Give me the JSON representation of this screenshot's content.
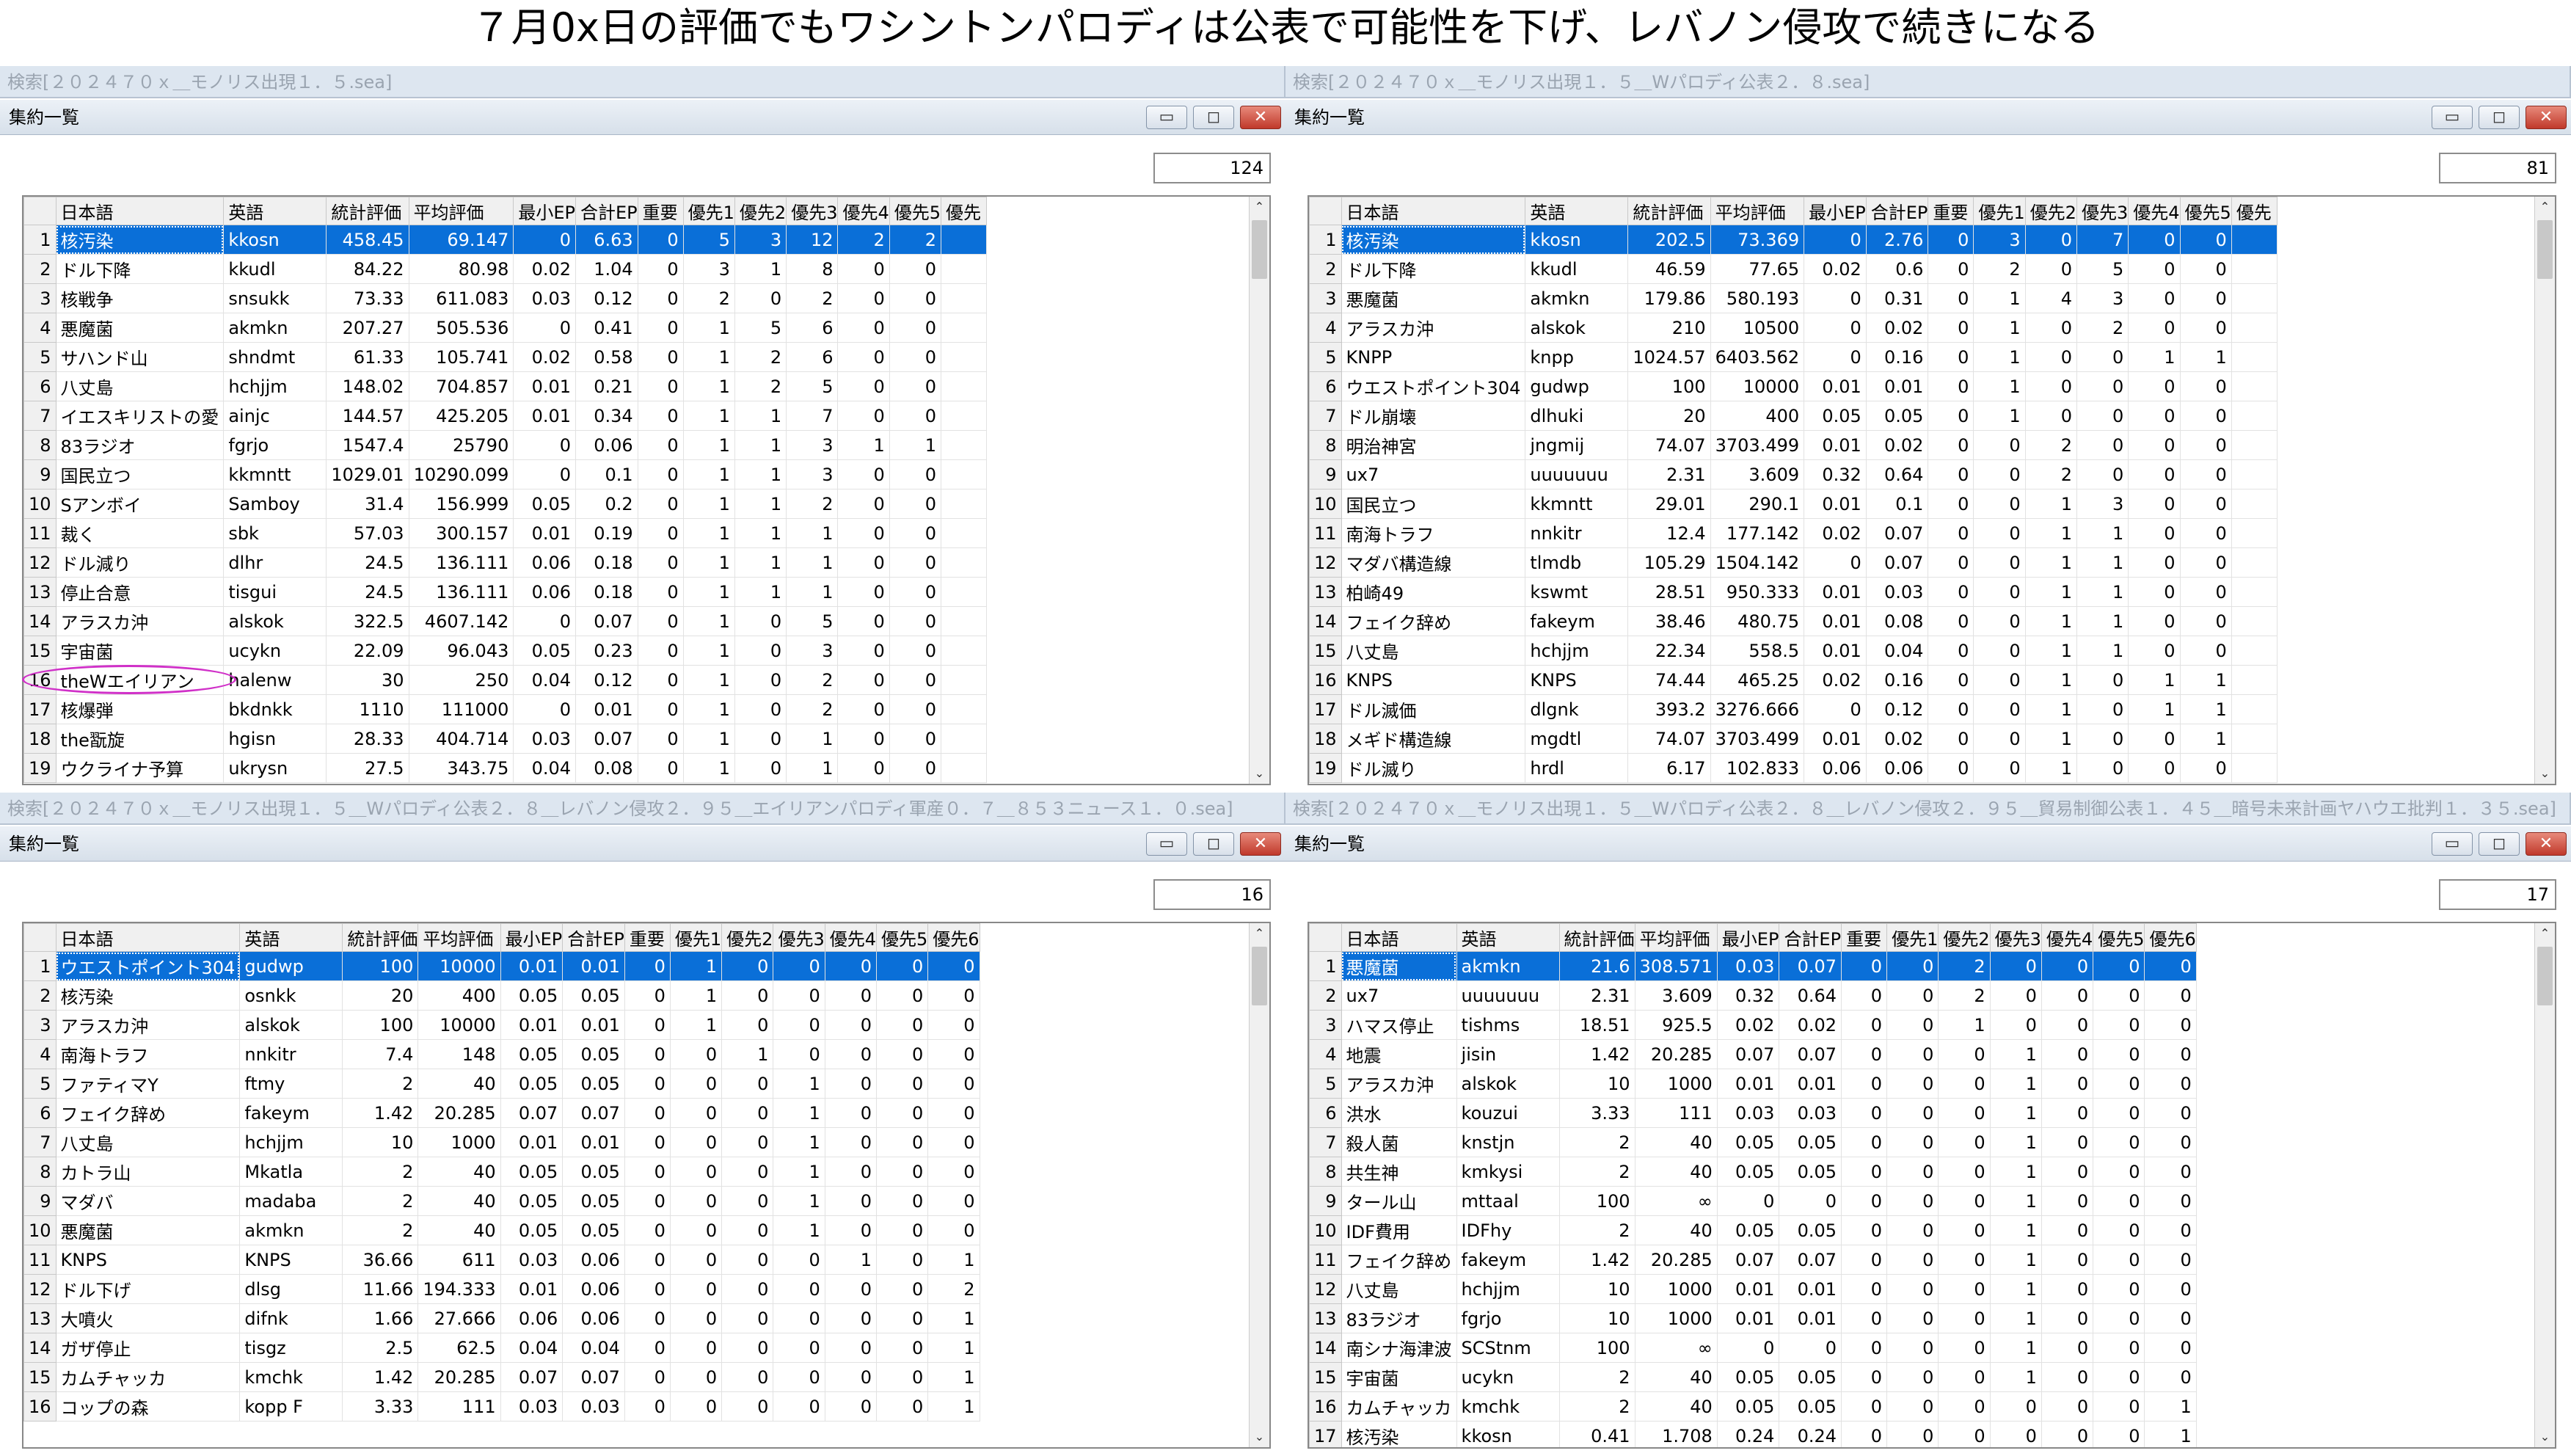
{
  "title": "７月0x日の評価でもワシントンパロディは公表で可能性を下げ、レバノン侵攻で続きになる",
  "panels": [
    {
      "search": "検索[２０２４７０ｘ＿モノリス出現１．５.sea]",
      "window_title": "集約一覧",
      "count": "124",
      "columns": [
        "日本語",
        "英語",
        "統計評価",
        "平均評価",
        "最小EP",
        "合計EP",
        "重要",
        "優先1",
        "優先2",
        "優先3",
        "優先4",
        "優先5",
        "優先"
      ],
      "rows": [
        [
          "1",
          "核汚染",
          "kkosn",
          "458.45",
          "69.147",
          "0",
          "6.63",
          "0",
          "5",
          "3",
          "12",
          "2",
          "2",
          ""
        ],
        [
          "2",
          "ドル下降",
          "kkudl",
          "84.22",
          "80.98",
          "0.02",
          "1.04",
          "0",
          "3",
          "1",
          "8",
          "0",
          "0",
          ""
        ],
        [
          "3",
          "核戦争",
          "snsukk",
          "73.33",
          "611.083",
          "0.03",
          "0.12",
          "0",
          "2",
          "0",
          "2",
          "0",
          "0",
          ""
        ],
        [
          "4",
          "悪魔菌",
          "akmkn",
          "207.27",
          "505.536",
          "0",
          "0.41",
          "0",
          "1",
          "5",
          "6",
          "0",
          "0",
          ""
        ],
        [
          "5",
          "サハンド山",
          "shndmt",
          "61.33",
          "105.741",
          "0.02",
          "0.58",
          "0",
          "1",
          "2",
          "6",
          "0",
          "0",
          ""
        ],
        [
          "6",
          "八丈島",
          "hchjjm",
          "148.02",
          "704.857",
          "0.01",
          "0.21",
          "0",
          "1",
          "2",
          "5",
          "0",
          "0",
          ""
        ],
        [
          "7",
          "イエスキリストの愛",
          "ainjc",
          "144.57",
          "425.205",
          "0.01",
          "0.34",
          "0",
          "1",
          "1",
          "7",
          "0",
          "0",
          ""
        ],
        [
          "8",
          "83ラジオ",
          "fgrjo",
          "1547.4",
          "25790",
          "0",
          "0.06",
          "0",
          "1",
          "1",
          "3",
          "1",
          "1",
          ""
        ],
        [
          "9",
          "国民立つ",
          "kkmntt",
          "1029.01",
          "10290.099",
          "0",
          "0.1",
          "0",
          "1",
          "1",
          "3",
          "0",
          "0",
          ""
        ],
        [
          "10",
          "Sアンボイ",
          "Samboy",
          "31.4",
          "156.999",
          "0.05",
          "0.2",
          "0",
          "1",
          "1",
          "2",
          "0",
          "0",
          ""
        ],
        [
          "11",
          "裁く",
          "sbk",
          "57.03",
          "300.157",
          "0.01",
          "0.19",
          "0",
          "1",
          "1",
          "1",
          "0",
          "0",
          ""
        ],
        [
          "12",
          "ドル減り",
          "dlhr",
          "24.5",
          "136.111",
          "0.06",
          "0.18",
          "0",
          "1",
          "1",
          "1",
          "0",
          "0",
          ""
        ],
        [
          "13",
          "停止合意",
          "tisgui",
          "24.5",
          "136.111",
          "0.06",
          "0.18",
          "0",
          "1",
          "1",
          "1",
          "0",
          "0",
          ""
        ],
        [
          "14",
          "アラスカ沖",
          "alskok",
          "322.5",
          "4607.142",
          "0",
          "0.07",
          "0",
          "1",
          "0",
          "5",
          "0",
          "0",
          ""
        ],
        [
          "15",
          "宇宙菌",
          "ucykn",
          "22.09",
          "96.043",
          "0.05",
          "0.23",
          "0",
          "1",
          "0",
          "3",
          "0",
          "0",
          ""
        ],
        [
          "16",
          "theWエイリアン",
          "halenw",
          "30",
          "250",
          "0.04",
          "0.12",
          "0",
          "1",
          "0",
          "2",
          "0",
          "0",
          ""
        ],
        [
          "17",
          "核爆弾",
          "bkdnkk",
          "1110",
          "111000",
          "0",
          "0.01",
          "0",
          "1",
          "0",
          "2",
          "0",
          "0",
          ""
        ],
        [
          "18",
          "the翫旋",
          "hgisn",
          "28.33",
          "404.714",
          "0.03",
          "0.07",
          "0",
          "1",
          "0",
          "1",
          "0",
          "0",
          ""
        ],
        [
          "19",
          "ウクライナ予算",
          "ukrysn",
          "27.5",
          "343.75",
          "0.04",
          "0.08",
          "0",
          "1",
          "0",
          "1",
          "0",
          "0",
          ""
        ]
      ]
    },
    {
      "search": "検索[２０２４７０ｘ＿モノリス出現１．５＿Wパロディ公表２．８.sea]",
      "window_title": "集約一覧",
      "count": "81",
      "columns": [
        "日本語",
        "英語",
        "統計評価",
        "平均評価",
        "最小EP",
        "合計EP",
        "重要",
        "優先1",
        "優先2",
        "優先3",
        "優先4",
        "優先5",
        "優先"
      ],
      "rows": [
        [
          "1",
          "核汚染",
          "kkosn",
          "202.5",
          "73.369",
          "0",
          "2.76",
          "0",
          "3",
          "0",
          "7",
          "0",
          "0",
          ""
        ],
        [
          "2",
          "ドル下降",
          "kkudl",
          "46.59",
          "77.65",
          "0.02",
          "0.6",
          "0",
          "2",
          "0",
          "5",
          "0",
          "0",
          ""
        ],
        [
          "3",
          "悪魔菌",
          "akmkn",
          "179.86",
          "580.193",
          "0",
          "0.31",
          "0",
          "1",
          "4",
          "3",
          "0",
          "0",
          ""
        ],
        [
          "4",
          "アラスカ沖",
          "alskok",
          "210",
          "10500",
          "0",
          "0.02",
          "0",
          "1",
          "0",
          "2",
          "0",
          "0",
          ""
        ],
        [
          "5",
          "KNPP",
          "knpp",
          "1024.57",
          "6403.562",
          "0",
          "0.16",
          "0",
          "1",
          "0",
          "0",
          "1",
          "1",
          ""
        ],
        [
          "6",
          "ウエストポイント304",
          "gudwp",
          "100",
          "10000",
          "0.01",
          "0.01",
          "0",
          "1",
          "0",
          "0",
          "0",
          "0",
          ""
        ],
        [
          "7",
          "ドル崩壊",
          "dlhuki",
          "20",
          "400",
          "0.05",
          "0.05",
          "0",
          "1",
          "0",
          "0",
          "0",
          "0",
          ""
        ],
        [
          "8",
          "明治神宮",
          "jngmij",
          "74.07",
          "3703.499",
          "0.01",
          "0.02",
          "0",
          "0",
          "2",
          "0",
          "0",
          "0",
          ""
        ],
        [
          "9",
          "ux7",
          "uuuuuuu",
          "2.31",
          "3.609",
          "0.32",
          "0.64",
          "0",
          "0",
          "2",
          "0",
          "0",
          "0",
          ""
        ],
        [
          "10",
          "国民立つ",
          "kkmntt",
          "29.01",
          "290.1",
          "0.01",
          "0.1",
          "0",
          "0",
          "1",
          "3",
          "0",
          "0",
          ""
        ],
        [
          "11",
          "南海トラフ",
          "nnkitr",
          "12.4",
          "177.142",
          "0.02",
          "0.07",
          "0",
          "0",
          "1",
          "1",
          "0",
          "0",
          ""
        ],
        [
          "12",
          "マダバ構造線",
          "tlmdb",
          "105.29",
          "1504.142",
          "0",
          "0.07",
          "0",
          "0",
          "1",
          "1",
          "0",
          "0",
          ""
        ],
        [
          "13",
          "柏崎49",
          "kswmt",
          "28.51",
          "950.333",
          "0.01",
          "0.03",
          "0",
          "0",
          "1",
          "1",
          "0",
          "0",
          ""
        ],
        [
          "14",
          "フェイク辞め",
          "fakeym",
          "38.46",
          "480.75",
          "0.01",
          "0.08",
          "0",
          "0",
          "1",
          "1",
          "0",
          "0",
          ""
        ],
        [
          "15",
          "八丈島",
          "hchjjm",
          "22.34",
          "558.5",
          "0.01",
          "0.04",
          "0",
          "0",
          "1",
          "1",
          "0",
          "0",
          ""
        ],
        [
          "16",
          "KNPS",
          "KNPS",
          "74.44",
          "465.25",
          "0.02",
          "0.16",
          "0",
          "0",
          "1",
          "0",
          "1",
          "1",
          ""
        ],
        [
          "17",
          "ドル滅価",
          "dlgnk",
          "393.2",
          "3276.666",
          "0",
          "0.12",
          "0",
          "0",
          "1",
          "0",
          "1",
          "1",
          ""
        ],
        [
          "18",
          "メギド構造線",
          "mgdtl",
          "74.07",
          "3703.499",
          "0.01",
          "0.02",
          "0",
          "0",
          "1",
          "0",
          "0",
          "1",
          ""
        ],
        [
          "19",
          "ドル滅り",
          "hrdl",
          "6.17",
          "102.833",
          "0.06",
          "0.06",
          "0",
          "0",
          "1",
          "0",
          "0",
          "0",
          ""
        ]
      ]
    },
    {
      "search": "検索[２０２４７０ｘ＿モノリス出現１．５＿Wパロディ公表２．８＿レバノン侵攻２．９５＿エイリアンパロディ軍産０．７＿８５３ニュース１．０.sea]",
      "window_title": "集約一覧",
      "count": "16",
      "columns": [
        "日本語",
        "英語",
        "統計評価",
        "平均評価",
        "最小EP",
        "合計EP",
        "重要",
        "優先1",
        "優先2",
        "優先3",
        "優先4",
        "優先5",
        "優先6"
      ],
      "rows": [
        [
          "1",
          "ウエストポイント304",
          "gudwp",
          "100",
          "10000",
          "0.01",
          "0.01",
          "0",
          "1",
          "0",
          "0",
          "0",
          "0",
          "0"
        ],
        [
          "2",
          "核汚染",
          "osnkk",
          "20",
          "400",
          "0.05",
          "0.05",
          "0",
          "1",
          "0",
          "0",
          "0",
          "0",
          "0"
        ],
        [
          "3",
          "アラスカ沖",
          "alskok",
          "100",
          "10000",
          "0.01",
          "0.01",
          "0",
          "1",
          "0",
          "0",
          "0",
          "0",
          "0"
        ],
        [
          "4",
          "南海トラフ",
          "nnkitr",
          "7.4",
          "148",
          "0.05",
          "0.05",
          "0",
          "0",
          "1",
          "0",
          "0",
          "0",
          "0"
        ],
        [
          "5",
          "ファティマY",
          "ftmy",
          "2",
          "40",
          "0.05",
          "0.05",
          "0",
          "0",
          "0",
          "1",
          "0",
          "0",
          "0"
        ],
        [
          "6",
          "フェイク辞め",
          "fakeym",
          "1.42",
          "20.285",
          "0.07",
          "0.07",
          "0",
          "0",
          "0",
          "1",
          "0",
          "0",
          "0"
        ],
        [
          "7",
          "八丈島",
          "hchjjm",
          "10",
          "1000",
          "0.01",
          "0.01",
          "0",
          "0",
          "0",
          "1",
          "0",
          "0",
          "0"
        ],
        [
          "8",
          "カトラ山",
          "Mkatla",
          "2",
          "40",
          "0.05",
          "0.05",
          "0",
          "0",
          "0",
          "1",
          "0",
          "0",
          "0"
        ],
        [
          "9",
          "マダバ",
          "madaba",
          "2",
          "40",
          "0.05",
          "0.05",
          "0",
          "0",
          "0",
          "1",
          "0",
          "0",
          "0"
        ],
        [
          "10",
          "悪魔菌",
          "akmkn",
          "2",
          "40",
          "0.05",
          "0.05",
          "0",
          "0",
          "0",
          "1",
          "0",
          "0",
          "0"
        ],
        [
          "11",
          "KNPS",
          "KNPS",
          "36.66",
          "611",
          "0.03",
          "0.06",
          "0",
          "0",
          "0",
          "0",
          "1",
          "0",
          "1"
        ],
        [
          "12",
          "ドル下げ",
          "dlsg",
          "11.66",
          "194.333",
          "0.01",
          "0.06",
          "0",
          "0",
          "0",
          "0",
          "0",
          "0",
          "2"
        ],
        [
          "13",
          "大噴火",
          "difnk",
          "1.66",
          "27.666",
          "0.06",
          "0.06",
          "0",
          "0",
          "0",
          "0",
          "0",
          "0",
          "1"
        ],
        [
          "14",
          "ガザ停止",
          "tisgz",
          "2.5",
          "62.5",
          "0.04",
          "0.04",
          "0",
          "0",
          "0",
          "0",
          "0",
          "0",
          "1"
        ],
        [
          "15",
          "カムチャッカ",
          "kmchk",
          "1.42",
          "20.285",
          "0.07",
          "0.07",
          "0",
          "0",
          "0",
          "0",
          "0",
          "0",
          "1"
        ],
        [
          "16",
          "コップの森",
          "kopp F",
          "3.33",
          "111",
          "0.03",
          "0.03",
          "0",
          "0",
          "0",
          "0",
          "0",
          "0",
          "1"
        ]
      ]
    },
    {
      "search": "検索[２０２４７０ｘ＿モノリス出現１．５＿Wパロディ公表２．８＿レバノン侵攻２．９５＿貿易制御公表１．４５＿暗号未来計画ヤハウエ批判１．３５.sea]",
      "window_title": "集約一覧",
      "count": "17",
      "columns": [
        "日本語",
        "英語",
        "統計評価",
        "平均評価",
        "最小EP",
        "合計EP",
        "重要",
        "優先1",
        "優先2",
        "優先3",
        "優先4",
        "優先5",
        "優先6"
      ],
      "rows": [
        [
          "1",
          "悪魔菌",
          "akmkn",
          "21.6",
          "308.571",
          "0.03",
          "0.07",
          "0",
          "0",
          "2",
          "0",
          "0",
          "0",
          "0"
        ],
        [
          "2",
          "ux7",
          "uuuuuuu",
          "2.31",
          "3.609",
          "0.32",
          "0.64",
          "0",
          "0",
          "2",
          "0",
          "0",
          "0",
          "0"
        ],
        [
          "3",
          "ハマス停止",
          "tishms",
          "18.51",
          "925.5",
          "0.02",
          "0.02",
          "0",
          "0",
          "1",
          "0",
          "0",
          "0",
          "0"
        ],
        [
          "4",
          "地震",
          "jisin",
          "1.42",
          "20.285",
          "0.07",
          "0.07",
          "0",
          "0",
          "0",
          "1",
          "0",
          "0",
          "0"
        ],
        [
          "5",
          "アラスカ沖",
          "alskok",
          "10",
          "1000",
          "0.01",
          "0.01",
          "0",
          "0",
          "0",
          "1",
          "0",
          "0",
          "0"
        ],
        [
          "6",
          "洪水",
          "kouzui",
          "3.33",
          "111",
          "0.03",
          "0.03",
          "0",
          "0",
          "0",
          "1",
          "0",
          "0",
          "0"
        ],
        [
          "7",
          "殺人菌",
          "knstjn",
          "2",
          "40",
          "0.05",
          "0.05",
          "0",
          "0",
          "0",
          "1",
          "0",
          "0",
          "0"
        ],
        [
          "8",
          "共生神",
          "kmkysi",
          "2",
          "40",
          "0.05",
          "0.05",
          "0",
          "0",
          "0",
          "1",
          "0",
          "0",
          "0"
        ],
        [
          "9",
          "タール山",
          "mttaal",
          "100",
          "∞",
          "0",
          "0",
          "0",
          "0",
          "0",
          "1",
          "0",
          "0",
          "0"
        ],
        [
          "10",
          "IDF費用",
          "IDFhy",
          "2",
          "40",
          "0.05",
          "0.05",
          "0",
          "0",
          "0",
          "1",
          "0",
          "0",
          "0"
        ],
        [
          "11",
          "フェイク辞め",
          "fakeym",
          "1.42",
          "20.285",
          "0.07",
          "0.07",
          "0",
          "0",
          "0",
          "1",
          "0",
          "0",
          "0"
        ],
        [
          "12",
          "八丈島",
          "hchjjm",
          "10",
          "1000",
          "0.01",
          "0.01",
          "0",
          "0",
          "0",
          "1",
          "0",
          "0",
          "0"
        ],
        [
          "13",
          "83ラジオ",
          "fgrjo",
          "10",
          "1000",
          "0.01",
          "0.01",
          "0",
          "0",
          "0",
          "1",
          "0",
          "0",
          "0"
        ],
        [
          "14",
          "南シナ海津波",
          "SCStnm",
          "100",
          "∞",
          "0",
          "0",
          "0",
          "0",
          "0",
          "1",
          "0",
          "0",
          "0"
        ],
        [
          "15",
          "宇宙菌",
          "ucykn",
          "2",
          "40",
          "0.05",
          "0.05",
          "0",
          "0",
          "0",
          "1",
          "0",
          "0",
          "0"
        ],
        [
          "16",
          "カムチャッカ",
          "kmchk",
          "2",
          "40",
          "0.05",
          "0.05",
          "0",
          "0",
          "0",
          "0",
          "0",
          "0",
          "1"
        ],
        [
          "17",
          "核汚染",
          "kkosn",
          "0.41",
          "1.708",
          "0.24",
          "0.24",
          "0",
          "0",
          "0",
          "0",
          "0",
          "0",
          "1"
        ]
      ]
    }
  ],
  "controls": {
    "minimize": "▭",
    "maximize": "◻",
    "close": "✕",
    "scroll_up": "⌃",
    "scroll_down": "⌄"
  },
  "colors": {
    "selected_row": "#0a6fd8",
    "highlight_ellipse": "#d030c8"
  }
}
